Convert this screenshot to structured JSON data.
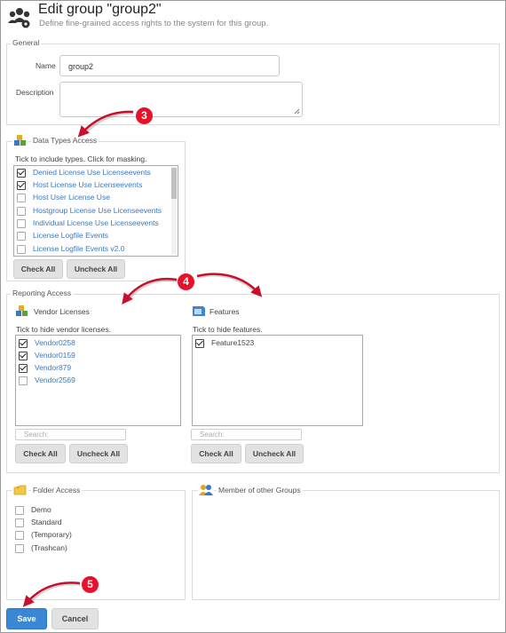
{
  "header": {
    "title": "Edit group \"group2\"",
    "subtitle": "Define fine-grained access rights to the system for this group."
  },
  "general": {
    "legend": "General",
    "name_label": "Name",
    "name_value": "group2",
    "description_label": "Description",
    "description_value": ""
  },
  "data_types": {
    "legend": "Data Types Access",
    "instruction": "Tick to include types. Click for masking.",
    "items": [
      {
        "label": "Denied License Use Licenseevents",
        "checked": true
      },
      {
        "label": "Host License Use Licenseevents",
        "checked": true
      },
      {
        "label": "Host User License Use",
        "checked": false
      },
      {
        "label": "Hostgroup License Use Licenseevents",
        "checked": false
      },
      {
        "label": "Individual License Use Licenseevents",
        "checked": false
      },
      {
        "label": "License Logfile Events",
        "checked": false
      },
      {
        "label": "License Logfile Events v2.0",
        "checked": false
      }
    ],
    "check_all": "Check All",
    "uncheck_all": "Uncheck All"
  },
  "reporting": {
    "legend": "Reporting Access",
    "vendor": {
      "title": "Vendor Licenses",
      "instruction": "Tick to hide vendor licenses.",
      "items": [
        {
          "label": "Vendor0258",
          "checked": true
        },
        {
          "label": "Vendor0159",
          "checked": true
        },
        {
          "label": "Vendor879",
          "checked": true
        },
        {
          "label": "Vendor2569",
          "checked": false
        }
      ],
      "search_placeholder": "Search:",
      "check_all": "Check All",
      "uncheck_all": "Uncheck All"
    },
    "features": {
      "title": "Features",
      "instruction": "Tick to hide features.",
      "items": [
        {
          "label": "Feature1523",
          "checked": true
        }
      ],
      "search_placeholder": "Search:",
      "check_all": "Check All",
      "uncheck_all": "Uncheck All"
    }
  },
  "folder_access": {
    "legend": "Folder Access",
    "items": [
      {
        "label": "Demo",
        "checked": false
      },
      {
        "label": "Standard",
        "checked": false
      },
      {
        "label": "(Temporary)",
        "checked": false
      },
      {
        "label": "(Trashcan)",
        "checked": false
      }
    ]
  },
  "member_groups": {
    "legend": "Member of other Groups"
  },
  "annotations": {
    "badge3": "3",
    "badge4": "4",
    "badge5": "5"
  },
  "footer": {
    "save": "Save",
    "cancel": "Cancel"
  },
  "colors": {
    "accent": "#3a87d6",
    "link": "#3a78c2",
    "badge": "#e8102a",
    "arrow": "#c8102e"
  }
}
